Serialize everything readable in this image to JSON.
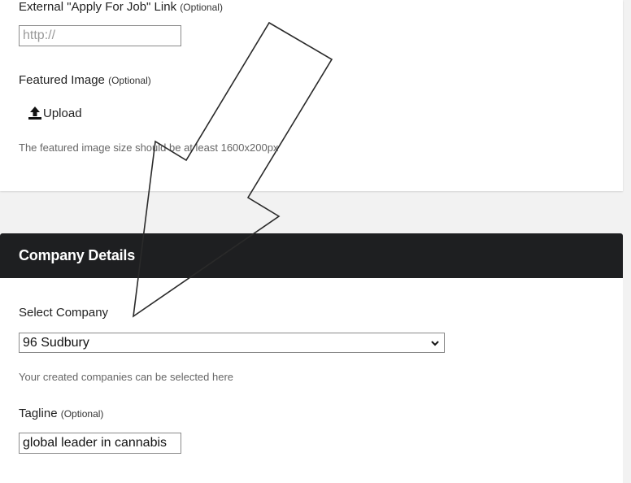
{
  "apply_link": {
    "label": "External \"Apply For Job\" Link",
    "optional": "(Optional)",
    "placeholder": "http://",
    "value": ""
  },
  "featured_image": {
    "label": "Featured Image",
    "optional": "(Optional)",
    "upload_label": "Upload",
    "upload_icon": "upload-icon",
    "hint": "The featured image size should be at least 1600x200px"
  },
  "company_details": {
    "title": "Company Details",
    "select_company": {
      "label": "Select Company",
      "selected": "96 Sudbury",
      "hint": "Your created companies can be selected here"
    },
    "tagline": {
      "label": "Tagline",
      "optional": "(Optional)",
      "value": "global leader in cannabis"
    }
  },
  "colors": {
    "header_bg": "#1e1f21",
    "page_bg": "#f2f2f2",
    "card_bg": "#ffffff"
  }
}
